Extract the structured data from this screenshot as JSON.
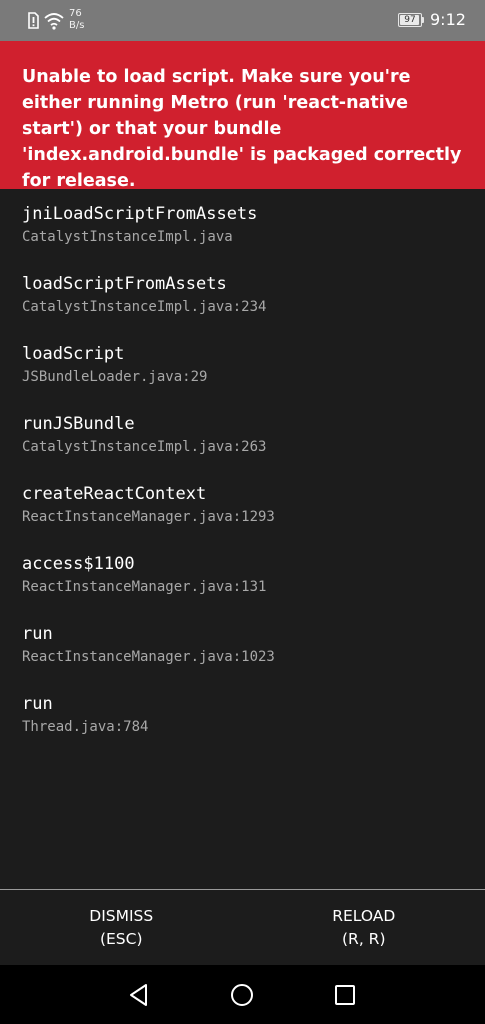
{
  "status_bar": {
    "net_speed_value": "76",
    "net_speed_unit": "B/s",
    "battery_level": "97",
    "time": "9:12",
    "icons": [
      "alert-icon",
      "wifi-icon",
      "battery-icon"
    ]
  },
  "error": {
    "message": "Unable to load script. Make sure you're either running Metro (run 'react-native start') or that your bundle 'index.android.bundle' is packaged correctly for release.",
    "background_color": "#d0202e"
  },
  "stack_trace": [
    {
      "method": "jniLoadScriptFromAssets",
      "file": "CatalystInstanceImpl.java"
    },
    {
      "method": "loadScriptFromAssets",
      "file": "CatalystInstanceImpl.java:234"
    },
    {
      "method": "loadScript",
      "file": "JSBundleLoader.java:29"
    },
    {
      "method": "runJSBundle",
      "file": "CatalystInstanceImpl.java:263"
    },
    {
      "method": "createReactContext",
      "file": "ReactInstanceManager.java:1293"
    },
    {
      "method": "access$1100",
      "file": "ReactInstanceManager.java:131"
    },
    {
      "method": "run",
      "file": "ReactInstanceManager.java:1023"
    },
    {
      "method": "run",
      "file": "Thread.java:784"
    }
  ],
  "footer": {
    "dismiss": {
      "label": "DISMISS",
      "shortcut": "(ESC)"
    },
    "reload": {
      "label": "RELOAD",
      "shortcut": "(R, R)"
    }
  },
  "nav_bar": {
    "icons": [
      "back-icon",
      "home-icon",
      "recents-icon"
    ]
  },
  "colors": {
    "status_bar": "#7a7a7a",
    "background": "#1c1c1c",
    "nav_bar": "#000000"
  }
}
